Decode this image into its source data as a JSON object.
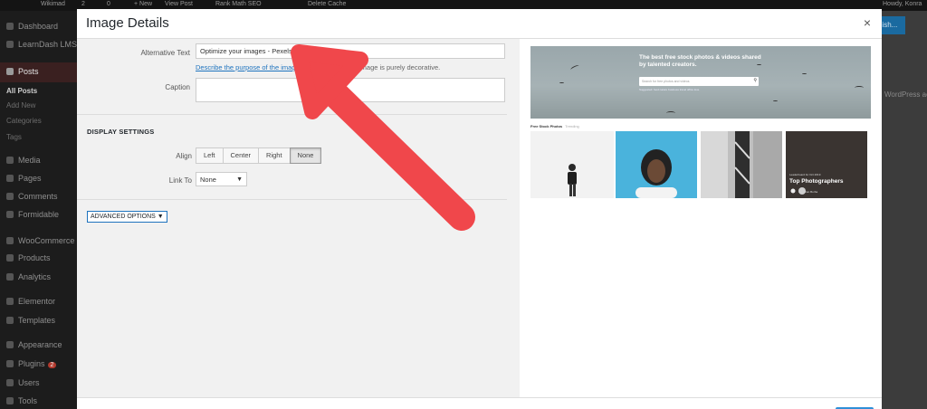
{
  "adminbar": {
    "site": "Wikimad",
    "updates": "2",
    "comments": "0",
    "new": "+ New",
    "view_post": "View Post",
    "rank_math": "Rank Math SEO",
    "delete_cache": "Delete Cache",
    "howdy": "Howdy, Konra"
  },
  "sidebar": {
    "items": [
      {
        "label": "Dashboard"
      },
      {
        "label": "LearnDash LMS"
      },
      {
        "label": "Posts"
      },
      {
        "label": "All Posts"
      },
      {
        "label": "Add New"
      },
      {
        "label": "Categories"
      },
      {
        "label": "Tags"
      },
      {
        "label": "Media"
      },
      {
        "label": "Pages"
      },
      {
        "label": "Comments"
      },
      {
        "label": "Formidable"
      },
      {
        "label": "WooCommerce"
      },
      {
        "label": "Products"
      },
      {
        "label": "Analytics"
      },
      {
        "label": "Elementor"
      },
      {
        "label": "Templates"
      },
      {
        "label": "Appearance"
      },
      {
        "label": "Plugins",
        "badge": "2"
      },
      {
        "label": "Users"
      },
      {
        "label": "Tools"
      }
    ]
  },
  "background": {
    "publish_label": "lish...",
    "wp_text": "WordPress ac"
  },
  "modal": {
    "title": "Image Details",
    "close_icon": "×",
    "alt_text": {
      "label": "Alternative Text",
      "value": "Optimize your images - Pexels",
      "help_link": "Describe the purpose of the imag",
      "help_rest": "the image is purely decorative."
    },
    "caption": {
      "label": "Caption",
      "value": ""
    },
    "display_settings": {
      "title": "DISPLAY SETTINGS",
      "align_label": "Align",
      "align_options": [
        "Left",
        "Center",
        "Right",
        "None"
      ],
      "align_selected": "None",
      "link_to_label": "Link To",
      "link_to_value": "None",
      "link_to_caret": "▼"
    },
    "advanced_options": "ADVANCED OPTIONS ▼"
  },
  "preview": {
    "hero_text": "The best free stock photos & videos shared by talented creators.",
    "search_placeholder": "Search for free photos and videos",
    "tags": "Suggested: food  nature  business  travel  office  love",
    "tab_active": "Free Stock Photos",
    "tab_other": "Trending",
    "overlay_sub": "Leaderboard for Oct 2019",
    "overlay_title": "Top Photographers",
    "overlay_user": "Jonathan Borba"
  },
  "colors": {
    "accent": "#1e73be",
    "annotation_arrow": "#f0474b"
  }
}
